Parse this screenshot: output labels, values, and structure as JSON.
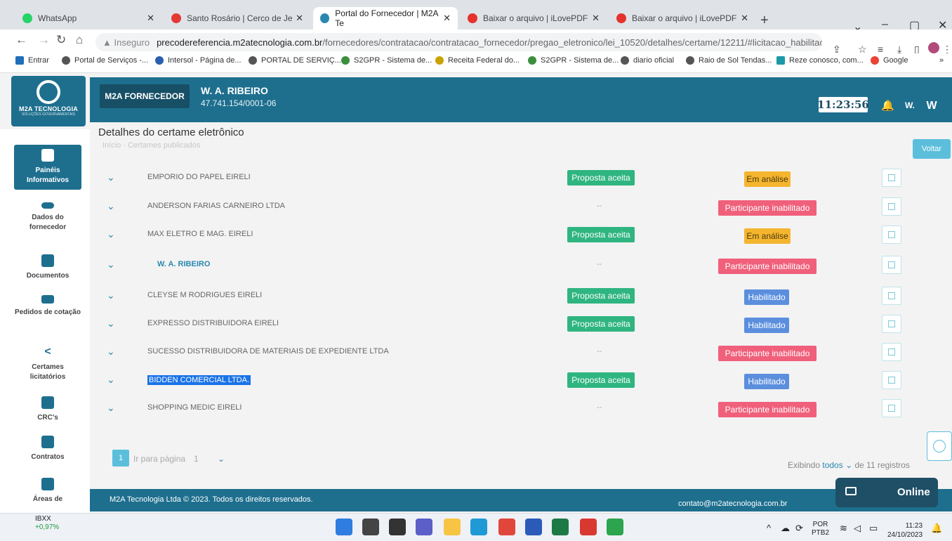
{
  "browser": {
    "tabs": [
      {
        "label": "WhatsApp",
        "color": "#25d366"
      },
      {
        "label": "Santo Rosário | Cerco de Je",
        "color": "#e53935"
      },
      {
        "label": "Portal do Fornecedor | M2A Te",
        "color": "#2a88b0"
      },
      {
        "label": "Baixar o arquivo | iLovePDF",
        "color": "#e5322d"
      },
      {
        "label": "Baixar o arquivo | iLovePDF",
        "color": "#e5322d"
      }
    ],
    "new_tab": "+",
    "insecure": "Inseguro",
    "url_host": "precodereferencia.m2atecnologia.com.br",
    "url_path": "/fornecedores/contratacao/contratacao_fornecedor/pregao_eletronico/lei_10520/detalhes/certame/12211/#licitacao_habilitaca...",
    "bookmarks": [
      "Entrar",
      "Portal de Serviços -...",
      "Intersol - Página de...",
      "PORTAL DE SERVIÇ...",
      "S2GPR - Sistema de...",
      "Receita Federal do...",
      "S2GPR - Sistema de...",
      "diario oficial",
      "Raio de Sol Tendas...",
      "Reze conosco, com...",
      "Google"
    ],
    "more": "»"
  },
  "app": {
    "logo_text": "M2A TECNOLOGIA",
    "logo_sub": "SOLUÇÕES GOVERNAMENTAIS",
    "role": "M2A FORNECEDOR",
    "company_name": "W. A. RIBEIRO",
    "company_cnpj": "47.741.154/0001-06",
    "clock": "11:23:56",
    "user_short": "W.",
    "user_initial": "W"
  },
  "sidebar": [
    {
      "label": "Painéis Informativos",
      "active": true
    },
    {
      "label": "Dados do fornecedor"
    },
    {
      "label": "Documentos"
    },
    {
      "label": "Pedidos de cotação"
    },
    {
      "label": "Certames licitatórios"
    },
    {
      "label": "CRC's"
    },
    {
      "label": "Contratos"
    },
    {
      "label": "Áreas de"
    }
  ],
  "content": {
    "title": "Detalhes do certame eletrônico",
    "breadcrumb": "Início · Certames publicados",
    "back": "Voltar",
    "proposal_label": "Proposta aceita",
    "rows": [
      {
        "name": "EMPORIO DO PAPEL EIRELI",
        "proposal": "Proposta aceita",
        "status": "Em análise",
        "kind": "analise"
      },
      {
        "name": "ANDERSON FARIAS CARNEIRO LTDA",
        "proposal": "--",
        "status": "Participante inabilitado",
        "kind": "inab"
      },
      {
        "name": "MAX ELETRO E MAG. EIRELI",
        "proposal": "Proposta aceita",
        "status": "Em análise",
        "kind": "analise"
      },
      {
        "name": "W. A. RIBEIRO",
        "proposal": "--",
        "status": "Participante inabilitado",
        "kind": "inab",
        "bold": true
      },
      {
        "name": "CLEYSE M RODRIGUES EIRELI",
        "proposal": "Proposta aceita",
        "status": "Habilitado",
        "kind": "hab"
      },
      {
        "name": "EXPRESSO DISTRIBUIDORA EIRELI",
        "proposal": "Proposta aceita",
        "status": "Habilitado",
        "kind": "hab"
      },
      {
        "name": "SUCESSO DISTRIBUIDORA DE MATERIAIS DE EXPEDIENTE LTDA",
        "proposal": "--",
        "status": "Participante inabilitado",
        "kind": "inab"
      },
      {
        "name": "BIDDEN COMERCIAL LTDA.",
        "proposal": "Proposta aceita",
        "status": "Habilitado",
        "kind": "hab",
        "selected": true
      },
      {
        "name": "SHOPPING MEDIC EIRELI",
        "proposal": "--",
        "status": "Participante inabilitado",
        "kind": "inab"
      }
    ],
    "pager": {
      "page": "1",
      "go_label": "Ir para página",
      "go_value": "1"
    },
    "showing_prefix": "Exibindo",
    "showing_select": "todos",
    "showing_suffix": "de 11 registros"
  },
  "footer": {
    "left": "M2A Tecnologia Ltda  © 2023. Todos os direitos reservados.",
    "right": "contato@m2atecnologia.com.br"
  },
  "chat": {
    "label": "Online"
  },
  "taskbar": {
    "stock_name": "IBXX",
    "stock_change": "+0,97%",
    "lang": "POR",
    "layout": "PTB2",
    "time": "11:23",
    "date": "24/10/2023",
    "apps": [
      {
        "name": "windows-start",
        "color": "#2f7de1"
      },
      {
        "name": "search",
        "color": "#444444"
      },
      {
        "name": "task-view",
        "color": "#333333"
      },
      {
        "name": "chat",
        "color": "#5b5fc7"
      },
      {
        "name": "file-explorer",
        "color": "#f7c543"
      },
      {
        "name": "edge",
        "color": "#1f9ad6"
      },
      {
        "name": "chrome",
        "color": "#e0463a"
      },
      {
        "name": "word",
        "color": "#2b5bb8"
      },
      {
        "name": "excel",
        "color": "#1d7a45"
      },
      {
        "name": "acrobat",
        "color": "#d93831"
      },
      {
        "name": "green-app",
        "color": "#2da44e"
      }
    ]
  }
}
